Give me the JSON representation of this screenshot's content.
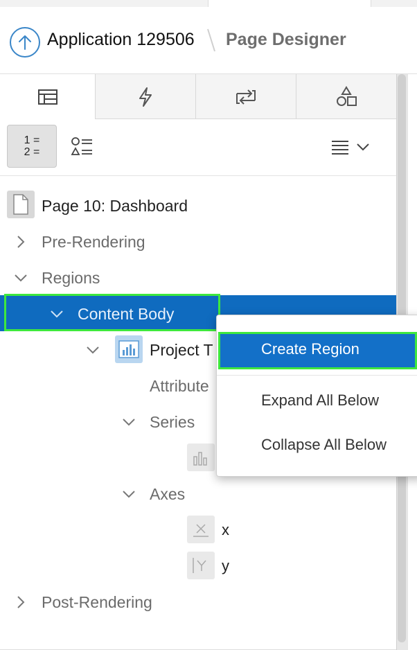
{
  "breadcrumb": {
    "app": "Application 129506",
    "page": "Page Designer"
  },
  "tabs": [
    {
      "name": "rendering",
      "icon": "table-icon",
      "active": true
    },
    {
      "name": "dynamic-actions",
      "icon": "lightning-icon",
      "active": false
    },
    {
      "name": "processing",
      "icon": "refresh-arrows-icon",
      "active": false
    },
    {
      "name": "shared-components",
      "icon": "shapes-icon",
      "active": false
    }
  ],
  "toolbar": {
    "ordered_view_label_1": "1 =",
    "ordered_view_label_2": "2 =",
    "grouped_view_icon": "component-list-icon",
    "menu_icon": "hamburger-menu-icon"
  },
  "tree": {
    "page": "Page 10: Dashboard",
    "pre_rendering": "Pre-Rendering",
    "regions": "Regions",
    "content_body": "Content Body",
    "chart_region": "Project T",
    "attributes": "Attribute",
    "series": "Series",
    "axes": "Axes",
    "axis_x": "x",
    "axis_y": "y",
    "post_rendering": "Post-Rendering"
  },
  "context_menu": {
    "create_region": "Create Region",
    "expand_all": "Expand All Below",
    "collapse_all": "Collapse All Below"
  },
  "colors": {
    "selected": "#0f6bbf",
    "menu_highlight": "#1370c8",
    "focus_outline": "#3ee83e",
    "accent": "#3a86c8"
  }
}
